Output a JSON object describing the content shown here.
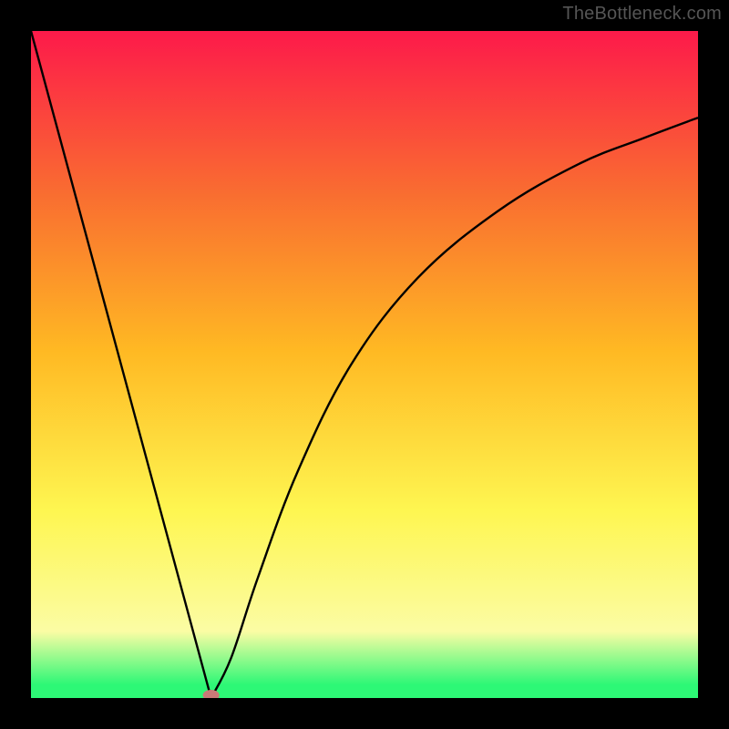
{
  "watermark": "TheBottleneck.com",
  "colors": {
    "frame": "#000000",
    "gradient_top": "#fd1a4a",
    "gradient_mid_upper": "#f96f30",
    "gradient_mid": "#ffb923",
    "gradient_mid_lower": "#fef651",
    "gradient_yellow_pale": "#fbfca4",
    "gradient_green": "#2df876",
    "curve": "#000000",
    "marker": "#c97a78"
  },
  "chart_data": {
    "type": "line",
    "title": "",
    "xlabel": "",
    "ylabel": "",
    "xlim": [
      0,
      100
    ],
    "ylim": [
      0,
      100
    ],
    "series": [
      {
        "name": "bottleneck-curve",
        "points": [
          {
            "x": 0,
            "y": 100
          },
          {
            "x": 27,
            "y": 0
          },
          {
            "x": 30,
            "y": 6
          },
          {
            "x": 34,
            "y": 18
          },
          {
            "x": 40,
            "y": 34
          },
          {
            "x": 48,
            "y": 50
          },
          {
            "x": 58,
            "y": 63
          },
          {
            "x": 70,
            "y": 73
          },
          {
            "x": 82,
            "y": 80
          },
          {
            "x": 92,
            "y": 84
          },
          {
            "x": 100,
            "y": 87
          }
        ]
      }
    ],
    "marker": {
      "x": 27,
      "y": 0
    }
  }
}
